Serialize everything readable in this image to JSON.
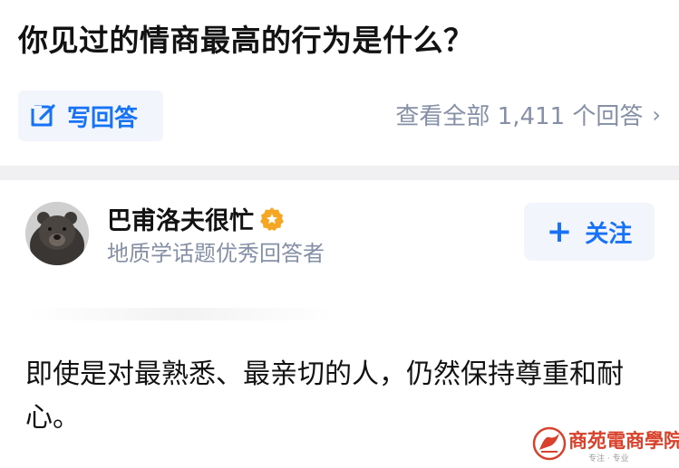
{
  "question": {
    "title": "你见过的情商最高的行为是什么？"
  },
  "actions": {
    "write_answer_label": "写回答",
    "view_all_label": "查看全部 1,411 个回答",
    "chevron": "›"
  },
  "author": {
    "name": "巴甫洛夫很忙",
    "title": "地质学话题优秀回答者",
    "badge_icon": "verified-badge-icon",
    "follow_label": "关注",
    "follow_icon": "+"
  },
  "answer": {
    "text": "即使是对最熟悉、最亲切的人，仍然保持尊重和耐心。"
  },
  "watermark": {
    "text": "商苑電商學院",
    "subtext": "专注 · 专业"
  },
  "colors": {
    "accent": "#1772f6",
    "muted": "#8590a6",
    "button_bg": "#f2f6fc",
    "divider": "#f0f0f2",
    "badge": "#f5a623",
    "watermark": "#d8412b"
  }
}
